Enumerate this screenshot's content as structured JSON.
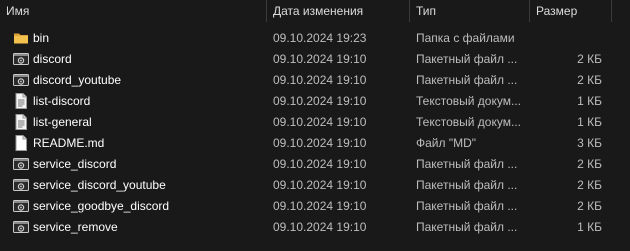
{
  "columns": {
    "name": "Имя",
    "date": "Дата изменения",
    "type": "Тип",
    "size": "Размер"
  },
  "files": [
    {
      "name": "bin",
      "date": "09.10.2024 19:23",
      "type": "Папка с файлами",
      "size": "",
      "icon": "folder-icon"
    },
    {
      "name": "discord",
      "date": "09.10.2024 19:10",
      "type": "Пакетный файл ...",
      "size": "2 КБ",
      "icon": "batch-file-icon"
    },
    {
      "name": "discord_youtube",
      "date": "09.10.2024 19:10",
      "type": "Пакетный файл ...",
      "size": "2 КБ",
      "icon": "batch-file-icon"
    },
    {
      "name": "list-discord",
      "date": "09.10.2024 19:10",
      "type": "Текстовый докум...",
      "size": "1 КБ",
      "icon": "text-file-icon"
    },
    {
      "name": "list-general",
      "date": "09.10.2024 19:10",
      "type": "Текстовый докум...",
      "size": "1 КБ",
      "icon": "text-file-icon"
    },
    {
      "name": "README.md",
      "date": "09.10.2024 19:10",
      "type": "Файл \"MD\"",
      "size": "3 КБ",
      "icon": "generic-file-icon"
    },
    {
      "name": "service_discord",
      "date": "09.10.2024 19:10",
      "type": "Пакетный файл ...",
      "size": "2 КБ",
      "icon": "batch-file-icon"
    },
    {
      "name": "service_discord_youtube",
      "date": "09.10.2024 19:10",
      "type": "Пакетный файл ...",
      "size": "2 КБ",
      "icon": "batch-file-icon"
    },
    {
      "name": "service_goodbye_discord",
      "date": "09.10.2024 19:10",
      "type": "Пакетный файл ...",
      "size": "2 КБ",
      "icon": "batch-file-icon"
    },
    {
      "name": "service_remove",
      "date": "09.10.2024 19:10",
      "type": "Пакетный файл ...",
      "size": "1 КБ",
      "icon": "batch-file-icon"
    }
  ],
  "colors": {
    "background": "#191919",
    "folder": "#e8b54a",
    "text_primary": "#ffffff",
    "text_secondary": "#bdbdbd"
  }
}
